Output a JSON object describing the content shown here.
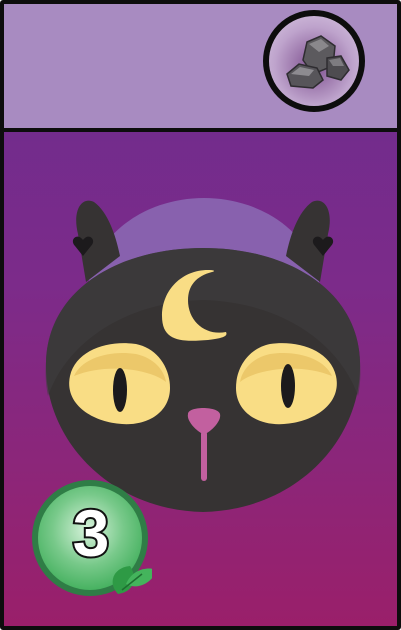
{
  "card": {
    "resource": {
      "icon": "rock-icon"
    },
    "art": {
      "icon": "black-cat-moon-icon"
    },
    "cost": {
      "value": "3",
      "icon": "leaf-icon",
      "color": "#3fae5a"
    }
  },
  "colors": {
    "header": "#a88bc1",
    "body_top": "#6b2c8e",
    "body_bottom": "#9a1f6a",
    "border": "#0d0d0d",
    "cat": "#363333",
    "eyes": "#f9dd85",
    "moon": "#f9dd85",
    "nose": "#c2609f"
  }
}
